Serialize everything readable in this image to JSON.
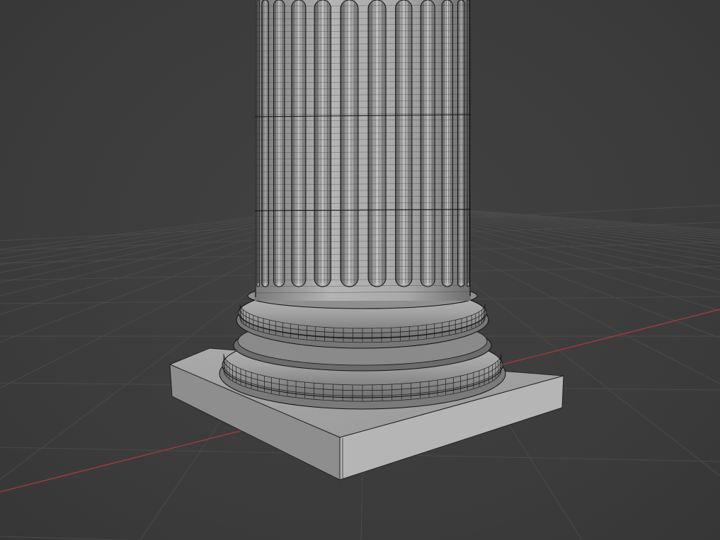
{
  "viewport": {
    "background_color": "#3d3d3d",
    "grid_line_color": "#4a4a4a",
    "x_axis_color": "#a03c3c",
    "mesh_surface_color": "#9a9a9a",
    "mesh_wire_color": "#1a1a1a",
    "object": "fluted-column-base-wireframe",
    "flutes_visible": 12
  }
}
